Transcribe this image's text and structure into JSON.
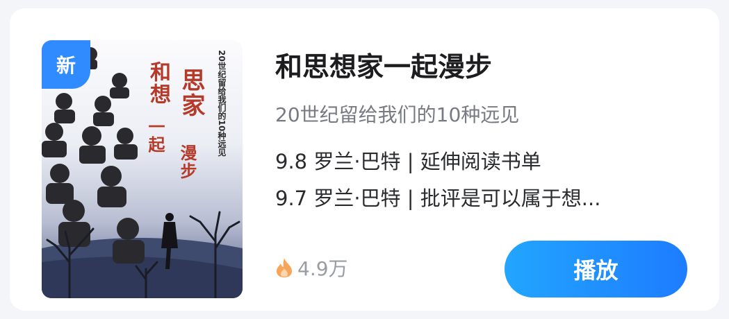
{
  "card": {
    "badge": "新",
    "title": "和思想家一起漫步",
    "subtitle": "20世纪留给我们的10种远见",
    "episodes": [
      "9.8 罗兰·巴特 | 延伸阅读书单",
      "9.7 罗兰·巴特 | 批评是可以属于想..."
    ],
    "play_count": "4.9万",
    "play_button": "播放"
  },
  "cover": {
    "title_col_right": "思家漫",
    "title_col_left": "和想一起步",
    "title_chars": [
      "和",
      "思",
      "想",
      "家",
      "一",
      "起",
      "漫",
      "步"
    ],
    "subtitle_vertical": "20世纪留给我们的10种远见"
  },
  "colors": {
    "accent": "#2f8bff",
    "button_gradient_start": "#22a5ff",
    "button_gradient_end": "#1d7cff",
    "cover_title": "#b53a2a",
    "fire_icon": "#f7a55a"
  },
  "icons": {
    "plays": "fire-icon"
  }
}
